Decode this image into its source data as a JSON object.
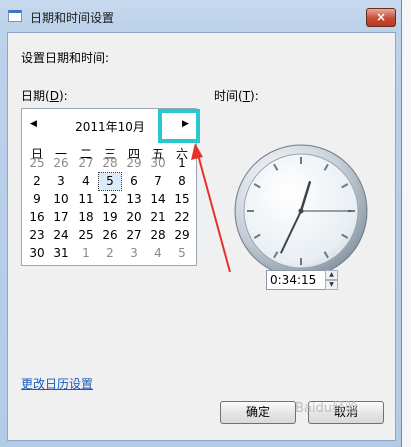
{
  "window": {
    "title": "日期和时间设置",
    "close": "×"
  },
  "header": {
    "text": "设置日期和时间:"
  },
  "date": {
    "label_prefix": "日期(",
    "label_key": "D",
    "label_suffix": "):"
  },
  "time": {
    "label_prefix": "时间(",
    "label_key": "T",
    "label_suffix": "):",
    "value": "0:34:15"
  },
  "calendar": {
    "month": "2011年10月",
    "prev": "◀",
    "next": "▶",
    "weekdays": [
      "日",
      "一",
      "二",
      "三",
      "四",
      "五",
      "六"
    ],
    "rows": [
      [
        "25",
        "26",
        "27",
        "28",
        "29",
        "30",
        "1"
      ],
      [
        "2",
        "3",
        "4",
        "5",
        "6",
        "7",
        "8"
      ],
      [
        "9",
        "10",
        "11",
        "12",
        "13",
        "14",
        "15"
      ],
      [
        "16",
        "17",
        "18",
        "19",
        "20",
        "21",
        "22"
      ],
      [
        "23",
        "24",
        "25",
        "26",
        "27",
        "28",
        "29"
      ],
      [
        "30",
        "31",
        "1",
        "2",
        "3",
        "4",
        "5"
      ]
    ],
    "selected": "5"
  },
  "clock": {
    "hours": 0,
    "minutes": 34,
    "seconds": 15
  },
  "link": "更改日历设置",
  "buttons": {
    "ok": "确定",
    "cancel": "取消"
  },
  "watermark": "Baidu经验",
  "colors": {
    "highlight": "#29c7cf",
    "arrow": "#e8312a",
    "link": "#1a5bbf"
  }
}
